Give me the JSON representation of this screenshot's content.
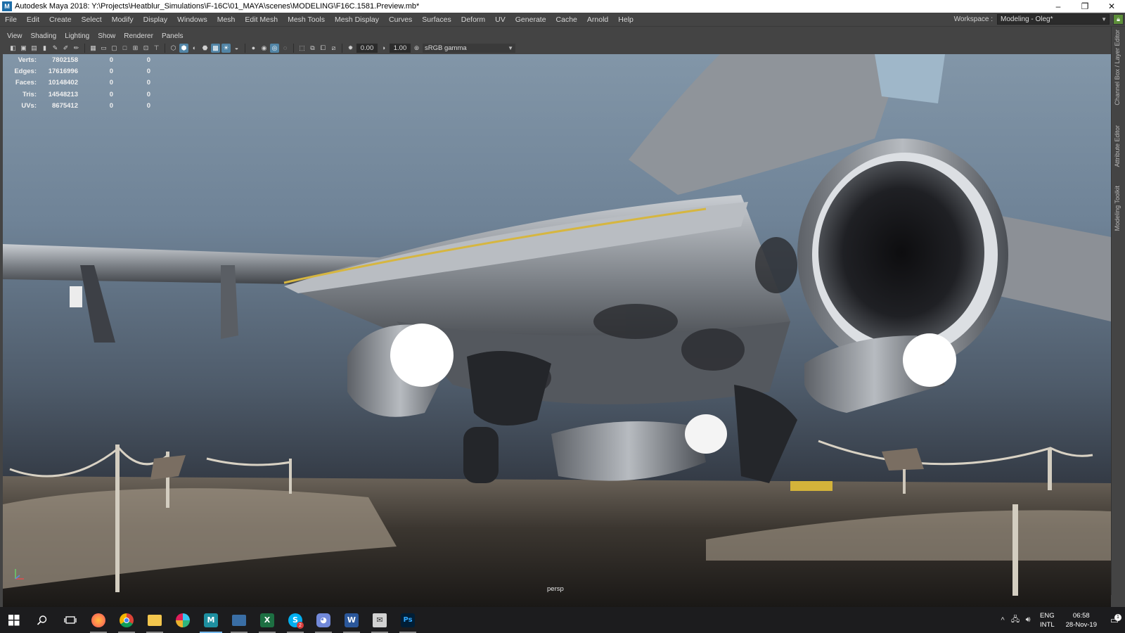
{
  "window": {
    "title": "Autodesk Maya 2018: Y:\\Projects\\Heatblur_Simulations\\F-16C\\01_MAYA\\scenes\\MODELING\\F16C.1581.Preview.mb*",
    "app_icon": "M",
    "minimize": "–",
    "restore": "❐",
    "close": "✕"
  },
  "menubar": {
    "items": [
      "File",
      "Edit",
      "Create",
      "Select",
      "Modify",
      "Display",
      "Windows",
      "Mesh",
      "Edit Mesh",
      "Mesh Tools",
      "Mesh Display",
      "Curves",
      "Surfaces",
      "Deform",
      "UV",
      "Generate",
      "Cache",
      "Arnold",
      "Help"
    ],
    "workspace_label": "Workspace :",
    "workspace_value": "Modeling - Oleg*"
  },
  "panel_menu": {
    "items": [
      "View",
      "Shading",
      "Lighting",
      "Show",
      "Renderer",
      "Panels"
    ]
  },
  "toolbar": {
    "exposure_value": "0.00",
    "gamma_value": "1.00",
    "color_space": "sRGB gamma"
  },
  "side_tabs": {
    "channel_box": "Channel Box / Layer Editor",
    "attribute_editor": "Attribute Editor",
    "modeling_toolkit": "Modeling Toolkit"
  },
  "hud": {
    "rows": [
      {
        "label": "Verts:",
        "total": "7802158",
        "selected": "0",
        "component": "0"
      },
      {
        "label": "Edges:",
        "total": "17616996",
        "selected": "0",
        "component": "0"
      },
      {
        "label": "Faces:",
        "total": "10148402",
        "selected": "0",
        "component": "0"
      },
      {
        "label": "Tris:",
        "total": "14548213",
        "selected": "0",
        "component": "0"
      },
      {
        "label": "UVs:",
        "total": "8675412",
        "selected": "0",
        "component": "0"
      }
    ],
    "camera": "persp"
  },
  "taskbar": {
    "apps": [
      "windows-start",
      "search",
      "task-view",
      "firefox",
      "chrome",
      "file-explorer",
      "slack",
      "maya",
      "window-app",
      "excel",
      "skype",
      "discord",
      "word",
      "outlook-app",
      "photoshop"
    ],
    "skype_badge": "2",
    "tray": {
      "lang_top": "ENG",
      "lang_bottom": "INTL",
      "time": "06:58",
      "date": "28-Nov-19",
      "notifications": "1"
    }
  },
  "colors": {
    "maya_ui": "#444444",
    "highlight": "#5285a6",
    "taskbar": "#1c1c1e"
  }
}
